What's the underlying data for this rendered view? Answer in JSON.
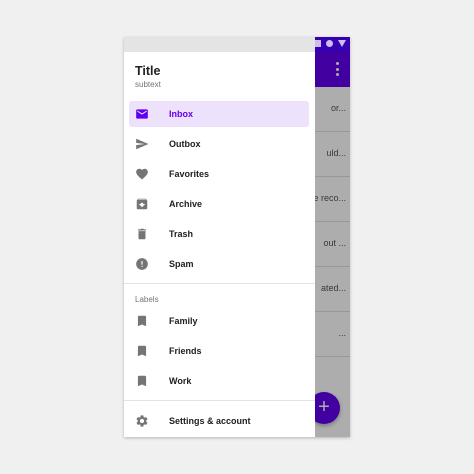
{
  "drawer": {
    "title": "Title",
    "subtext": "subtext",
    "primary_items": [
      {
        "label": "Inbox",
        "icon": "mail-icon",
        "active": true
      },
      {
        "label": "Outbox",
        "icon": "send-icon",
        "active": false
      },
      {
        "label": "Favorites",
        "icon": "heart-icon",
        "active": false
      },
      {
        "label": "Archive",
        "icon": "archive-icon",
        "active": false
      },
      {
        "label": "Trash",
        "icon": "trash-icon",
        "active": false
      },
      {
        "label": "Spam",
        "icon": "spam-icon",
        "active": false
      }
    ],
    "labels_heading": "Labels",
    "label_items": [
      {
        "label": "Family",
        "icon": "bookmark-icon"
      },
      {
        "label": "Friends",
        "icon": "bookmark-icon"
      },
      {
        "label": "Work",
        "icon": "bookmark-icon"
      }
    ],
    "settings": {
      "label": "Settings & account",
      "icon": "gear-icon"
    }
  },
  "background_list": {
    "snippets": [
      "or...",
      "uld...",
      "e reco...",
      "out ...",
      "ated...",
      "..."
    ]
  },
  "fab": {
    "label": "+"
  },
  "colors": {
    "primary": "#6200ee",
    "primary_dark": "#3700b3",
    "active_bg": "#ede1fb",
    "icon_gray": "#757575"
  }
}
